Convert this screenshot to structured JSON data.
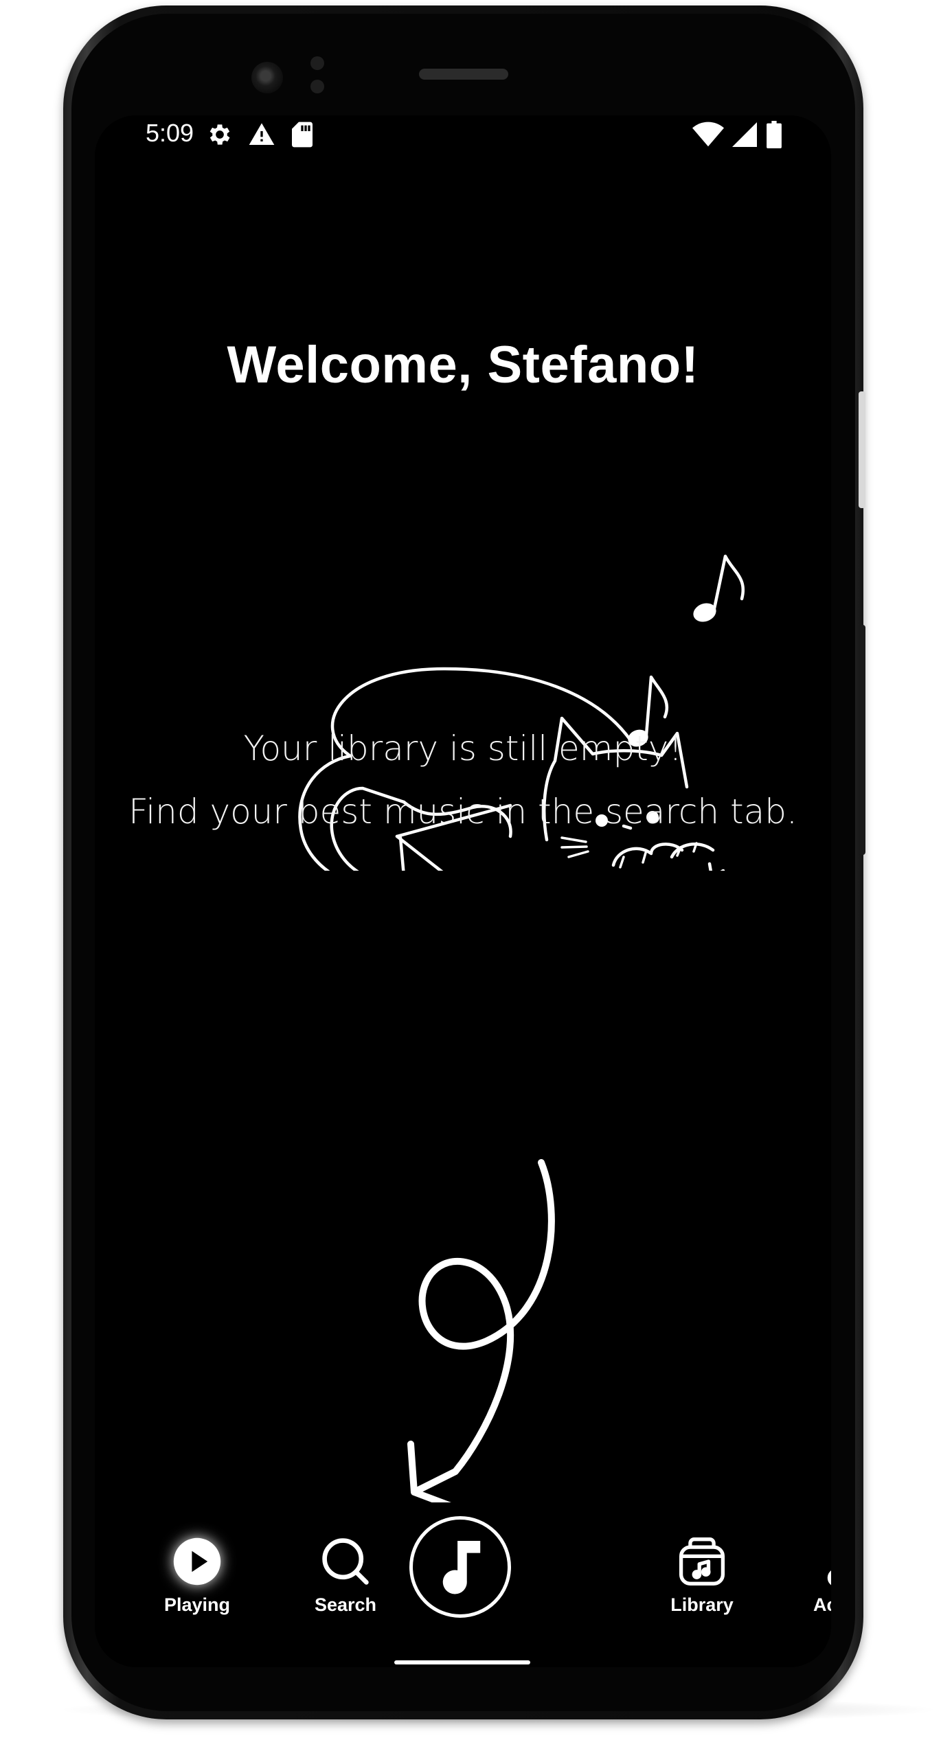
{
  "status_bar": {
    "time": "5:09",
    "left_icons": [
      "gear-icon",
      "warning-icon",
      "sd-card-icon"
    ],
    "right_icons": [
      "wifi-icon",
      "signal-icon",
      "battery-icon"
    ]
  },
  "main": {
    "welcome": "Welcome, Stefano!",
    "empty_line_1": "Your library is still empty!",
    "empty_line_2": "Find your best music in the search tab."
  },
  "bottom_nav": {
    "items": [
      {
        "label": "Playing",
        "icon": "play-circle-icon",
        "active": true
      },
      {
        "label": "Search",
        "icon": "search-icon"
      },
      {
        "label": "",
        "icon": "music-note-icon"
      },
      {
        "label": "Library",
        "icon": "library-bag-icon"
      },
      {
        "label": "Account",
        "icon": "account-icon"
      }
    ]
  },
  "colors": {
    "background": "#000000",
    "foreground": "#ffffff"
  }
}
